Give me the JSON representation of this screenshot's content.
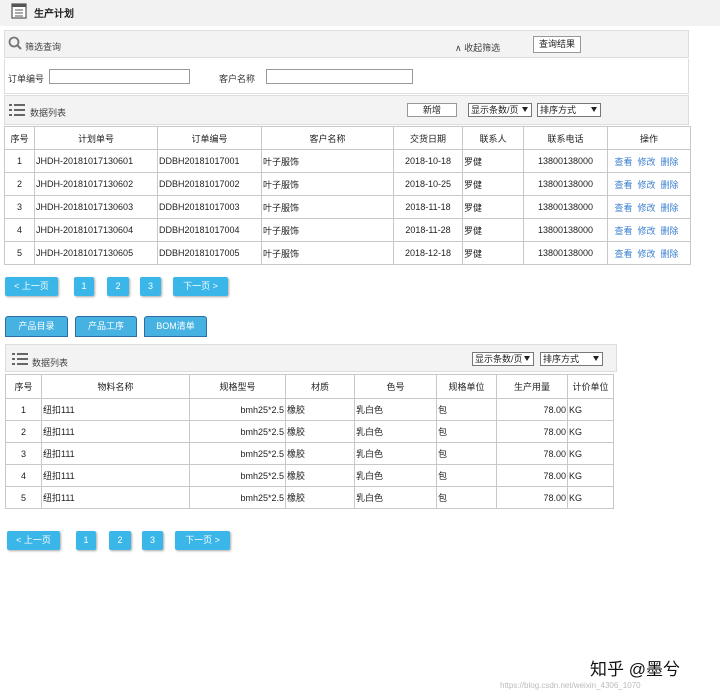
{
  "header": {
    "title": "生产计划"
  },
  "filter": {
    "title": "筛选查询",
    "collapse_label": "收起筛选",
    "query_button": "查询结果",
    "order_no_label": "订单编号",
    "order_no_value": "",
    "customer_label": "客户名称",
    "customer_value": ""
  },
  "plan_list": {
    "title": "数据列表",
    "add_button": "新增",
    "page_size_select": "显示条数/页",
    "sort_select": "排序方式",
    "columns": [
      "序号",
      "计划单号",
      "订单编号",
      "客户名称",
      "交货日期",
      "联系人",
      "联系电话",
      "操作"
    ],
    "rows": [
      [
        "1",
        "JHDH-20181017130601",
        "DDBH20181017001",
        "叶子服饰",
        "2018-10-18",
        "罗健",
        "13800138000"
      ],
      [
        "2",
        "JHDH-20181017130602",
        "DDBH20181017002",
        "叶子服饰",
        "2018-10-25",
        "罗健",
        "13800138000"
      ],
      [
        "3",
        "JHDH-20181017130603",
        "DDBH20181017003",
        "叶子服饰",
        "2018-11-18",
        "罗健",
        "13800138000"
      ],
      [
        "4",
        "JHDH-20181017130604",
        "DDBH20181017004",
        "叶子服饰",
        "2018-11-28",
        "罗健",
        "13800138000"
      ],
      [
        "5",
        "JHDH-20181017130605",
        "DDBH20181017005",
        "叶子服饰",
        "2018-12-18",
        "罗健",
        "13800138000"
      ]
    ],
    "actions": [
      "查看",
      "修改",
      "删除"
    ]
  },
  "pager": {
    "prev": "< 上一页",
    "pages": [
      "1",
      "2",
      "3"
    ],
    "next": "下一页 >"
  },
  "tabs": [
    "产品目录",
    "产品工序",
    "BOM清单"
  ],
  "material_list": {
    "title": "数据列表",
    "page_size_select": "显示条数/页",
    "sort_select": "排序方式",
    "columns": [
      "序号",
      "物料名称",
      "规格型号",
      "材质",
      "色号",
      "规格单位",
      "生产用量",
      "计价单位"
    ],
    "rows": [
      [
        "1",
        "纽扣111",
        "bmh25*2.5",
        "橡胶",
        "乳白色",
        "包",
        "78.00",
        "KG"
      ],
      [
        "2",
        "纽扣111",
        "bmh25*2.5",
        "橡胶",
        "乳白色",
        "包",
        "78.00",
        "KG"
      ],
      [
        "3",
        "纽扣111",
        "bmh25*2.5",
        "橡胶",
        "乳白色",
        "包",
        "78.00",
        "KG"
      ],
      [
        "4",
        "纽扣111",
        "bmh25*2.5",
        "橡胶",
        "乳白色",
        "包",
        "78.00",
        "KG"
      ],
      [
        "5",
        "纽扣111",
        "bmh25*2.5",
        "橡胶",
        "乳白色",
        "包",
        "78.00",
        "KG"
      ]
    ]
  },
  "watermark": {
    "text": "知乎 @墨兮",
    "url": "https://blog.csdn.net/weixin_4306_1070"
  }
}
